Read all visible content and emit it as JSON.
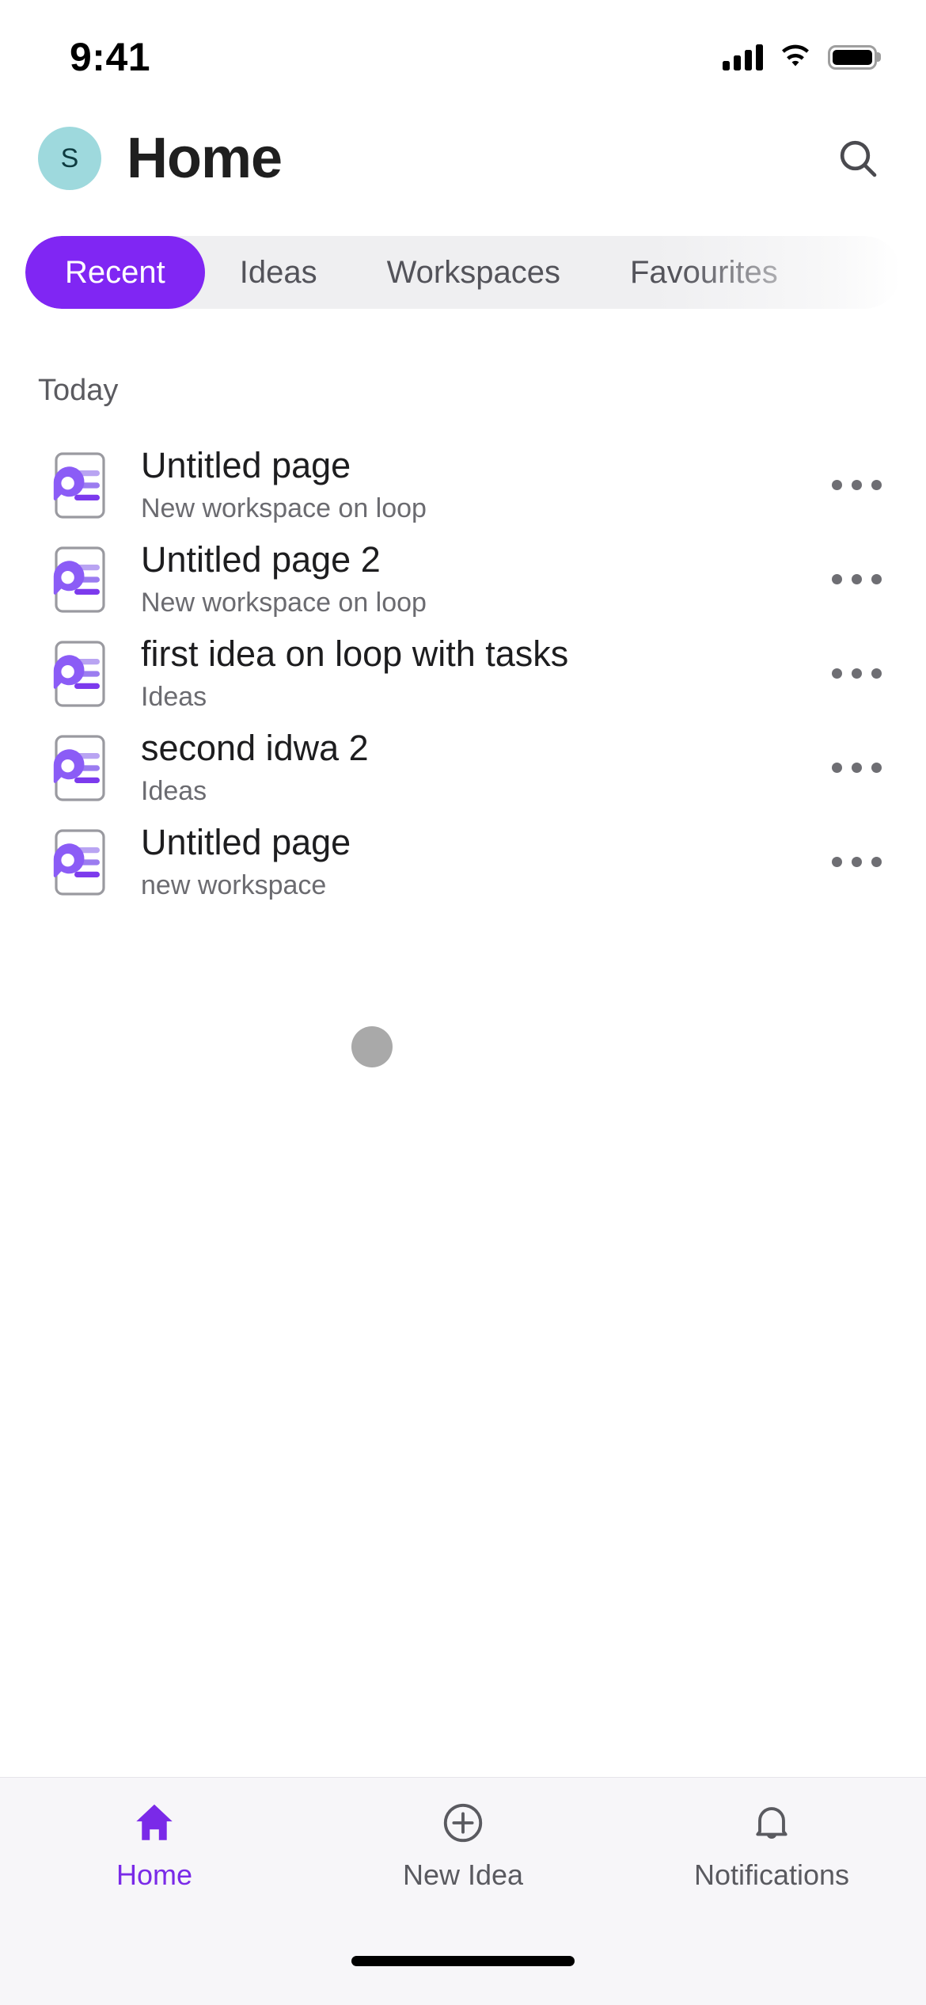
{
  "status_bar": {
    "time": "9:41",
    "signal_icon": "cellular-signal-icon",
    "wifi_icon": "wifi-icon",
    "battery_icon": "battery-full-icon"
  },
  "header": {
    "avatar_initial": "S",
    "avatar_bg": "#9ed9dd",
    "avatar_fg": "#0d3b40",
    "title": "Home",
    "search_icon": "search-icon"
  },
  "tabs": {
    "active_index": 0,
    "items": [
      {
        "label": "Recent"
      },
      {
        "label": "Ideas"
      },
      {
        "label": "Workspaces"
      },
      {
        "label": "Favourites"
      }
    ],
    "accent": "#8026f3",
    "track_bg": "#efeff1"
  },
  "list": {
    "section_label": "Today",
    "more_icon": "more-horizontal-icon",
    "item_icon": "loop-page-icon",
    "items": [
      {
        "title": "Untitled page",
        "subtitle": "New workspace on loop"
      },
      {
        "title": "Untitled page 2",
        "subtitle": "New workspace on loop"
      },
      {
        "title": "first idea on loop with tasks",
        "subtitle": "Ideas"
      },
      {
        "title": "second idwa 2",
        "subtitle": "Ideas"
      },
      {
        "title": "Untitled page",
        "subtitle": "new workspace"
      }
    ]
  },
  "touch_indicator": {
    "visible": true,
    "color": "rgba(90,90,90,0.52)"
  },
  "bottom_nav": {
    "active_index": 0,
    "active_color": "#7a2ae8",
    "items": [
      {
        "label": "Home",
        "icon": "home-icon"
      },
      {
        "label": "New Idea",
        "icon": "plus-circle-icon"
      },
      {
        "label": "Notifications",
        "icon": "bell-icon"
      }
    ]
  }
}
